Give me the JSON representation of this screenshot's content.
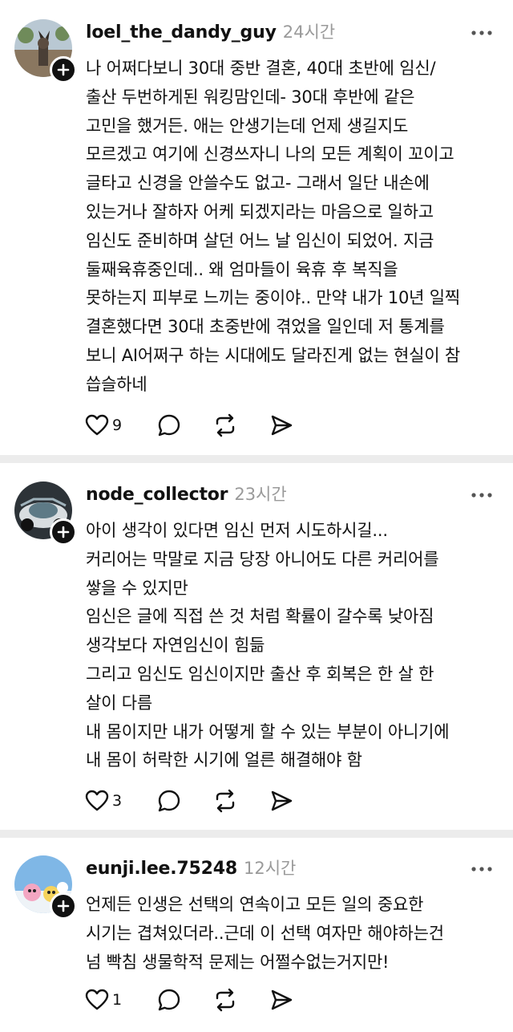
{
  "comments": [
    {
      "username": "loel_the_dandy_guy",
      "time": "24시간",
      "avatar_icon": "profile-photo-dog",
      "lines": [
        "나 어쩌다보니 30대 중반 결혼, 40대 초반에 임신/",
        "출산 두번하게된 워킹맘인데- 30대 후반에 같은",
        "고민을 했거든. 애는 안생기는데 언제 생길지도",
        "모르겠고 여기에 신경쓰자니 나의 모든 계획이 꼬이고",
        "글타고 신경을 안쓸수도 없고- 그래서 일단 내손에",
        "있는거나 잘하자 어케 되겠지라는 마음으로 일하고",
        "임신도 준비하며 살던 어느 날 임신이 되었어. 지금",
        "둘째육휴중인데.. 왜 엄마들이 육휴 후 복직을",
        "못하는지 피부로 느끼는 중이야.. 만약 내가 10년 일찍",
        "결혼했다면 30대 초중반에 겪었을 일인데 저 통계를",
        "보니 AI어쩌구 하는 시대에도 달라진게 없는 현실이 참",
        "씁슬하네"
      ],
      "likes": "9"
    },
    {
      "username": "node_collector",
      "time": "23시간",
      "avatar_icon": "profile-photo-car",
      "lines": [
        "아이 생각이 있다면 임신 먼저 시도하시길...",
        "커리어는 막말로 지금 당장 아니어도 다른 커리어를",
        "쌓을 수 있지만",
        "임신은 글에 직접 쓴 것 처럼 확률이 갈수록 낮아짐",
        "생각보다 자연임신이 힘듦",
        "그리고 임신도 임신이지만 출산 후 회복은 한 살 한",
        "살이 다름",
        "내 몸이지만 내가 어떻게 할 수 있는 부분이 아니기에",
        "내 몸이 허락한 시기에 얼른 해결해야 함"
      ],
      "likes": "3"
    },
    {
      "username": "eunji.lee.75248",
      "time": "12시간",
      "avatar_icon": "profile-photo-cartoon",
      "lines": [
        "언제든 인생은 선택의 연속이고 모든 일의 중요한",
        "시기는 겹쳐있더라..근데 이 선택 여자만 해야하는건",
        "넘 빡침 생물학적 문제는 어쩔수없는거지만!"
      ],
      "likes": "1"
    }
  ],
  "icons": {
    "like": "heart-icon",
    "reply": "comment-icon",
    "repost": "repost-icon",
    "share": "send-icon",
    "more": "more-dots-icon",
    "follow": "plus-icon"
  },
  "colors": {
    "text": "#111111",
    "muted": "#9a9a9a",
    "divider": "#ececec"
  }
}
